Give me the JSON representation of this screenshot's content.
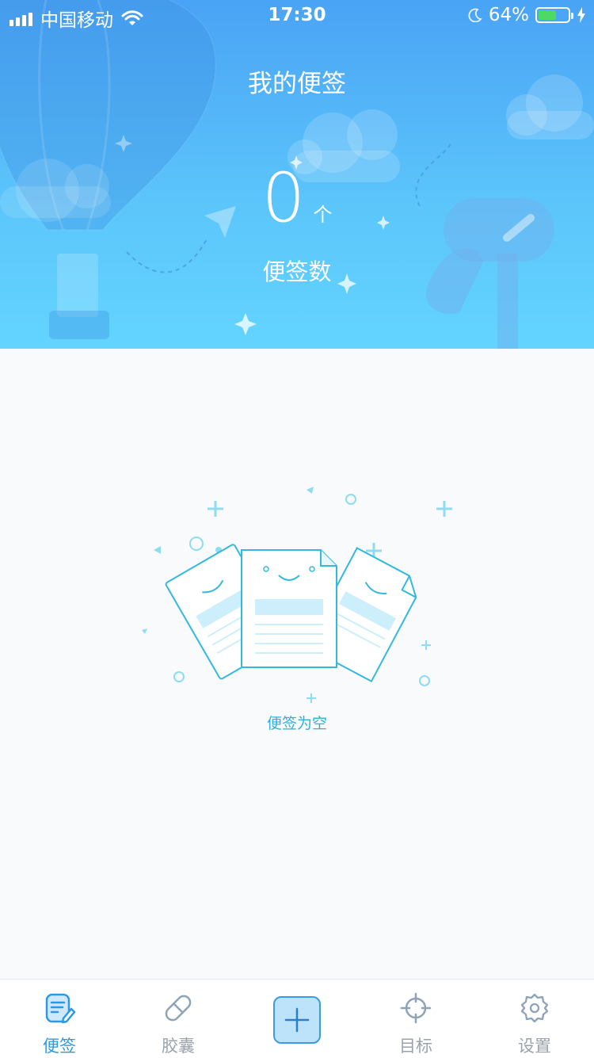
{
  "status_bar": {
    "carrier": "中国移动",
    "time": "17:30",
    "battery_percent": "64%",
    "battery_level": 0.64
  },
  "header": {
    "title": "我的便签",
    "count": "0",
    "count_unit": "个",
    "count_label": "便签数"
  },
  "empty_state": {
    "text": "便签为空"
  },
  "tabbar": {
    "items": [
      {
        "label": "便签",
        "icon": "note-icon",
        "active": true
      },
      {
        "label": "胶囊",
        "icon": "capsule-icon",
        "active": false
      },
      {
        "label": "",
        "icon": "plus-icon",
        "active": false
      },
      {
        "label": "目标",
        "icon": "target-icon",
        "active": false
      },
      {
        "label": "设置",
        "icon": "gear-icon",
        "active": false
      }
    ]
  },
  "colors": {
    "header_top": "#4aa3f5",
    "header_bottom": "#63d4ff",
    "accent": "#2a9ae6",
    "empty_text": "#2fb1da",
    "inactive_tab": "#9aa2ab"
  }
}
